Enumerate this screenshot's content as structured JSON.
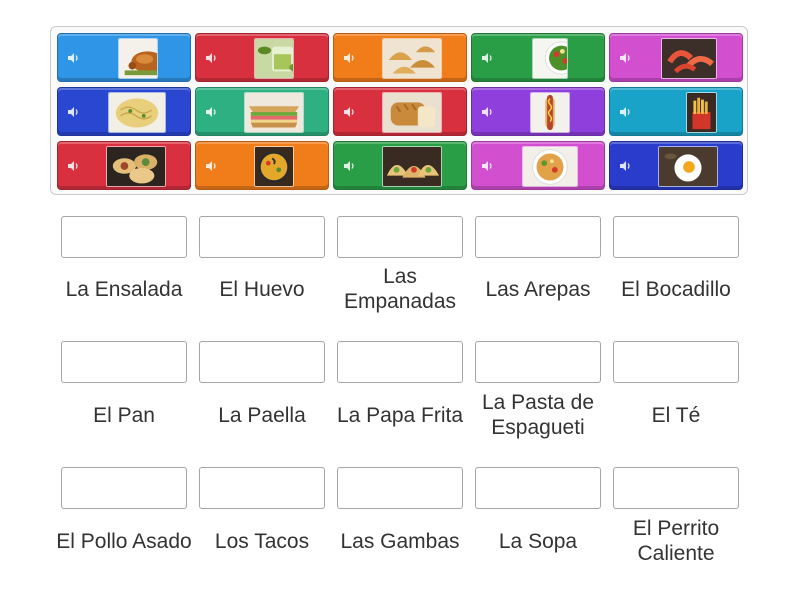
{
  "colors": {
    "blue": "#2f95e6",
    "red": "#d9303f",
    "orange": "#f07d1a",
    "green": "#2a9e47",
    "purple": "#c33cd1",
    "teal": "#1aa3c9",
    "navy": "#2a47d1",
    "mint": "#2fb082",
    "violet": "#8f3fdc",
    "pink": "#d24fd0",
    "indigo": "#2a3ccc"
  },
  "tiles": [
    {
      "color": "blue",
      "icon": "speaker-icon",
      "image": "roast-chicken-image"
    },
    {
      "color": "red",
      "icon": "speaker-icon",
      "image": "tea-image"
    },
    {
      "color": "orange",
      "icon": "speaker-icon",
      "image": "empanadas-image"
    },
    {
      "color": "green",
      "icon": "speaker-icon",
      "image": "salad-image"
    },
    {
      "color": "pink",
      "icon": "speaker-icon",
      "image": "shrimp-image"
    },
    {
      "color": "navy",
      "icon": "speaker-icon",
      "image": "spaghetti-image"
    },
    {
      "color": "mint",
      "icon": "speaker-icon",
      "image": "sandwich-image"
    },
    {
      "color": "red",
      "icon": "speaker-icon",
      "image": "bread-image"
    },
    {
      "color": "violet",
      "icon": "speaker-icon",
      "image": "hot-dog-image"
    },
    {
      "color": "teal",
      "icon": "speaker-icon",
      "image": "fries-image"
    },
    {
      "color": "red",
      "icon": "speaker-icon",
      "image": "arepas-image"
    },
    {
      "color": "orange",
      "icon": "speaker-icon",
      "image": "paella-image"
    },
    {
      "color": "green",
      "icon": "speaker-icon",
      "image": "tacos-image"
    },
    {
      "color": "pink",
      "icon": "speaker-icon",
      "image": "soup-image"
    },
    {
      "color": "indigo",
      "icon": "speaker-icon",
      "image": "egg-image"
    }
  ],
  "labels": [
    "La Ensalada",
    "El Huevo",
    "Las Empanadas",
    "Las Arepas",
    "El Bocadillo",
    "El Pan",
    "La Paella",
    "La Papa Frita",
    "La Pasta de Espagueti",
    "El Té",
    "El Pollo Asado",
    "Los Tacos",
    "Las Gambas",
    "La Sopa",
    "El Perrito Caliente"
  ]
}
